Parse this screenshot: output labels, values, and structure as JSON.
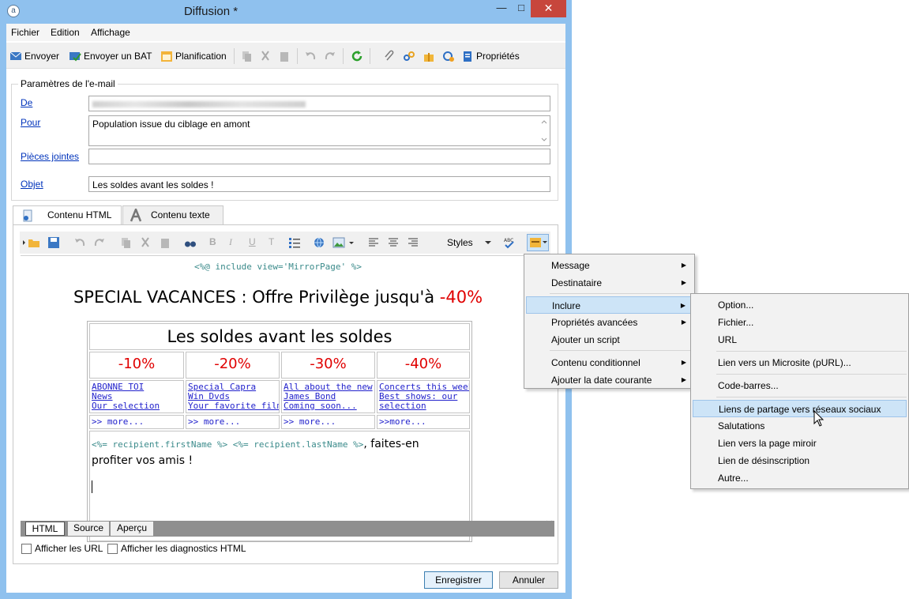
{
  "window": {
    "title": "Diffusion *",
    "controls": {
      "minimize": "—",
      "maximize": "□",
      "close": "✕"
    },
    "app_icon": "adobe-campaign-icon"
  },
  "menubar": {
    "items": [
      "Fichier",
      "Edition",
      "Affichage"
    ]
  },
  "toolbar": {
    "send": "Envoyer",
    "send_bat": "Envoyer un BAT",
    "planning": "Planification",
    "properties": "Propriétés"
  },
  "email_params": {
    "group_title": "Paramètres de l'e-mail",
    "from_label": "De",
    "to_label": "Pour",
    "to_value": "Population issue du ciblage en amont",
    "attachments_label": "Pièces jointes",
    "subject_label": "Objet",
    "subject_value": "Les soldes avant les soldes !"
  },
  "content_tabs": {
    "html": "Contenu HTML",
    "text": "Contenu texte"
  },
  "editor_toolbar": {
    "styles": "Styles"
  },
  "editor": {
    "include_line": "<%@ include view='MirrorPage' %>",
    "headline_main": "SPECIAL VACANCES : Offre Privilège jusqu'à ",
    "headline_pct": "-40%",
    "table_title": "Les soldes avant les soldes",
    "columns": [
      {
        "pct": "-10%",
        "links": [
          "ABONNE TOI",
          "News",
          "Our selection"
        ],
        "more": ">> more..."
      },
      {
        "pct": "-20%",
        "links": [
          "Special Capra",
          "Win Dvds",
          "Your favorite films"
        ],
        "more": ">> more..."
      },
      {
        "pct": "-30%",
        "links": [
          "All about the new",
          "James Bond",
          "Coming soon..."
        ],
        "more": ">> more..."
      },
      {
        "pct": "-40%",
        "links": [
          "Concerts this week",
          "Best shows: our",
          "selection"
        ],
        "more": ">>more..."
      }
    ],
    "code_text": "<%= recipient.firstName %> <%= recipient.lastName %>",
    "tail_text": ", faites-en",
    "tail_text2": "profiter vos amis !"
  },
  "bottom_tabs": [
    "HTML",
    "Source",
    "Aperçu"
  ],
  "checkboxes": {
    "show_urls": "Afficher les URL",
    "show_diag": "Afficher les diagnostics HTML"
  },
  "buttons": {
    "save": "Enregistrer",
    "cancel": "Annuler"
  },
  "context_menu": {
    "items": [
      {
        "label": "Message",
        "submenu": true
      },
      {
        "label": "Destinataire",
        "submenu": true
      },
      {
        "label": "Inclure",
        "submenu": true,
        "highlighted": true
      },
      {
        "label": "Propriétés avancées",
        "submenu": true
      },
      {
        "label": "Ajouter un script",
        "submenu": false
      },
      {
        "label": "Contenu conditionnel",
        "submenu": true
      },
      {
        "label": "Ajouter la date courante",
        "submenu": true
      }
    ]
  },
  "submenu": {
    "items": [
      "Option...",
      "Fichier...",
      "URL",
      "Lien vers un Microsite (pURL)...",
      "Code-barres...",
      "Liens de partage vers réseaux sociaux",
      "Salutations",
      "Lien vers la page miroir",
      "Lien de désinscription",
      "Autre..."
    ],
    "highlighted_index": 5
  },
  "colors": {
    "title_bar": "#8fc1ee",
    "close_button": "#c7463c",
    "highlight": "#cde4f7",
    "red_text": "#e00000"
  }
}
